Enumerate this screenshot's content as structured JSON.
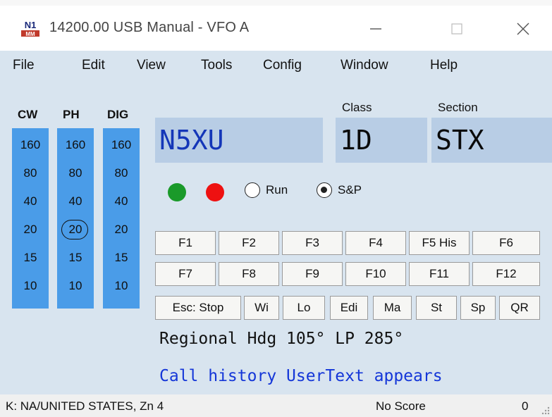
{
  "window": {
    "title": "14200.00 USB Manual - VFO A",
    "logo_text": "N1MM",
    "controls": [
      "minimize-icon",
      "maximize-icon",
      "close-icon"
    ]
  },
  "menu": [
    {
      "label": "File"
    },
    {
      "label": "Edit"
    },
    {
      "label": "View"
    },
    {
      "label": "Tools"
    },
    {
      "label": "Config"
    },
    {
      "label": "Window"
    },
    {
      "label": "Help"
    }
  ],
  "bands": {
    "columns": [
      {
        "header": "CW",
        "items": [
          "160",
          "80",
          "40",
          "20",
          "15",
          "10"
        ]
      },
      {
        "header": "PH",
        "items": [
          "160",
          "80",
          "40",
          "20",
          "15",
          "10"
        ],
        "selected": "20"
      },
      {
        "header": "DIG",
        "items": [
          "160",
          "80",
          "40",
          "20",
          "15",
          "10"
        ]
      }
    ],
    "column_color": "#4a9ce8"
  },
  "entry": {
    "call": "N5XU",
    "class_label": "Class",
    "class_value": "1D",
    "section_label": "Section",
    "section_value": "STX"
  },
  "indicators": {
    "green": "#1a9a2a",
    "red": "#ee1111"
  },
  "mode": {
    "run_label": "Run",
    "sp_label": "S&P",
    "selected": "S&P"
  },
  "function_keys": {
    "row1": [
      "F1",
      "F2",
      "F3",
      "F4",
      "F5 His",
      "F6"
    ],
    "row2": [
      "F7",
      "F8",
      "F9",
      "F10",
      "F11",
      "F12"
    ],
    "row3": [
      "Esc: Stop",
      "Wi",
      "Lo",
      "Edi",
      "Ma",
      "St",
      "Sp",
      "QR"
    ]
  },
  "info": {
    "heading": "Regional Hdg 105° LP 285°",
    "user_text": "Call history UserText appears"
  },
  "status": {
    "location": "K: NA/UNITED STATES, Zn 4",
    "score": "No Score",
    "count": "0"
  }
}
